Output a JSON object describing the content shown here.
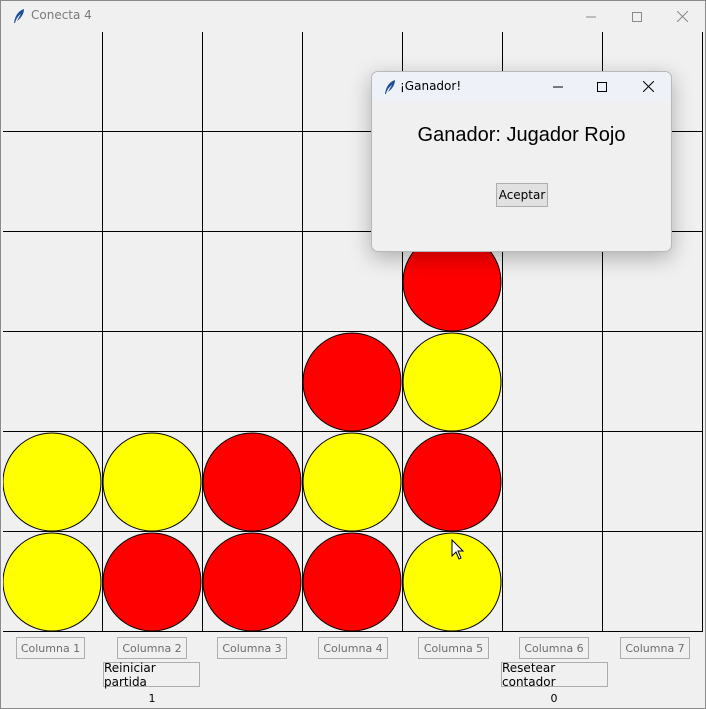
{
  "window": {
    "title": "Conecta 4",
    "app_icon": "feather-icon"
  },
  "colors": {
    "red": "#ff0000",
    "yellow": "#ffff00",
    "grid": "#000000",
    "background": "#f0f0f0"
  },
  "board": {
    "columns": 7,
    "rows": 6,
    "cells": [
      [
        "",
        "",
        "",
        "",
        "",
        "",
        ""
      ],
      [
        "",
        "",
        "",
        "",
        "",
        "",
        ""
      ],
      [
        "",
        "",
        "",
        "",
        "R",
        "",
        ""
      ],
      [
        "",
        "",
        "",
        "R",
        "Y",
        "",
        ""
      ],
      [
        "Y",
        "Y",
        "R",
        "Y",
        "R",
        "",
        ""
      ],
      [
        "Y",
        "R",
        "R",
        "R",
        "Y",
        "",
        ""
      ]
    ]
  },
  "column_buttons": [
    {
      "label": "Columna 1"
    },
    {
      "label": "Columna 2"
    },
    {
      "label": "Columna 3"
    },
    {
      "label": "Columna 4"
    },
    {
      "label": "Columna 5"
    },
    {
      "label": "Columna 6"
    },
    {
      "label": "Columna 7"
    }
  ],
  "controls": {
    "restart_label": "Reiniciar partida",
    "reset_counter_label": "Resetear contador",
    "red_wins": "1",
    "yellow_wins": "0"
  },
  "dialog": {
    "title": "¡Ganador!",
    "message": "Ganador: Jugador Rojo",
    "ok_label": "Aceptar"
  }
}
